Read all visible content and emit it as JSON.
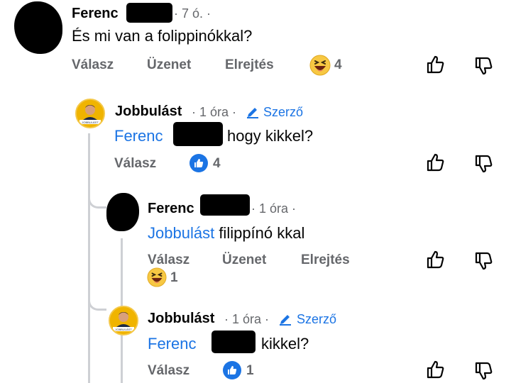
{
  "actions": {
    "reply": "Válasz",
    "message": "Üzenet",
    "hide": "Elrejtés"
  },
  "comments": [
    {
      "author": "Ferenc",
      "time": "· 7 ó. ·",
      "text": "És mi van a folippinókkal?",
      "reaction": "haha-emoji",
      "reaction_count": "4"
    },
    {
      "author": "Jobbulást",
      "time": "· 1 óra ·",
      "badge": "Szerző",
      "mention": "Ferenc",
      "text": "hogy kikkel?",
      "reaction": "like",
      "reaction_count": "4",
      "avatar_text": "JOBBULÁST"
    },
    {
      "author": "Ferenc",
      "time": "· 1 óra ·",
      "mention": "Jobbulást",
      "text": "filippínó kkal",
      "reaction": "haha-emoji",
      "reaction_count": "1"
    },
    {
      "author": "Jobbulást",
      "time": "· 1 óra ·",
      "badge": "Szerző",
      "mention": "Ferenc",
      "text": "kikkel?",
      "reaction": "like",
      "reaction_count": "1",
      "avatar_text": "JOBBULÁST"
    }
  ],
  "colors": {
    "link": "#1b74e4",
    "meta": "#65676b",
    "text": "#050505",
    "thread_line": "#ced0d4"
  }
}
